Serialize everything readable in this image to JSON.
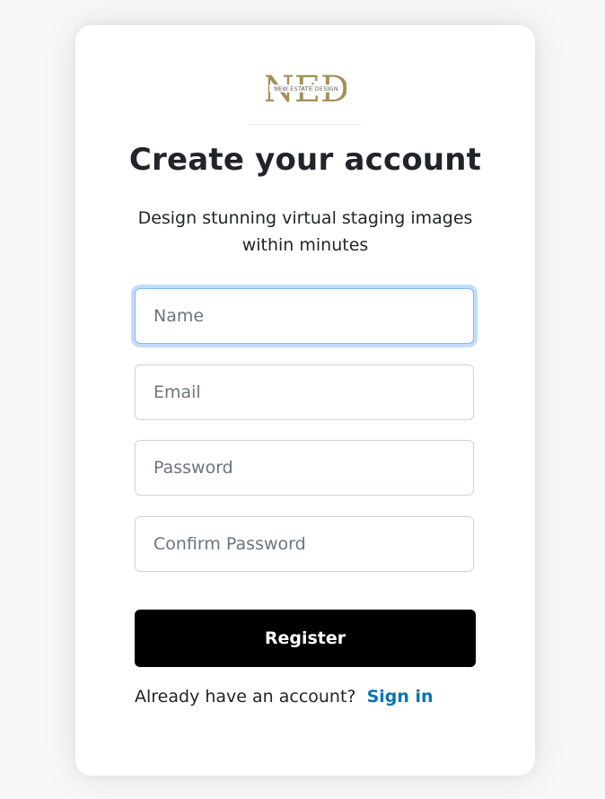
{
  "brand": {
    "logo_text": "NED",
    "logo_subtext": "NEW ESTATE DESIGN",
    "logo_color": "#a3915a"
  },
  "form": {
    "title": "Create your account",
    "subtitle": "Design stunning virtual staging images within minutes",
    "fields": [
      {
        "name": "name",
        "placeholder": "Name",
        "value": "",
        "focused": true
      },
      {
        "name": "email",
        "placeholder": "Email",
        "value": ""
      },
      {
        "name": "password",
        "placeholder": "Password",
        "value": ""
      },
      {
        "name": "confirm_password",
        "placeholder": "Confirm Password",
        "value": ""
      }
    ],
    "submit_label": "Register",
    "signin_prompt": "Already have an account?",
    "signin_link": "Sign in"
  },
  "colors": {
    "button_bg": "#000000",
    "link": "#0b74b0",
    "focus_ring": "#86b7fe"
  }
}
